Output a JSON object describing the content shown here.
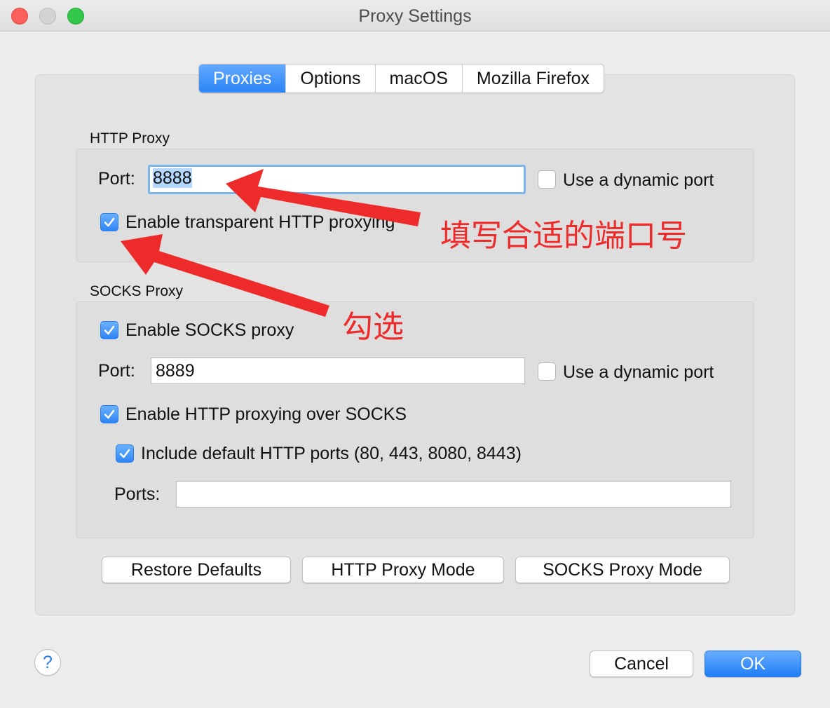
{
  "window": {
    "title": "Proxy Settings"
  },
  "tabs": [
    {
      "label": "Proxies",
      "active": true
    },
    {
      "label": "Options",
      "active": false
    },
    {
      "label": "macOS",
      "active": false
    },
    {
      "label": "Mozilla Firefox",
      "active": false
    }
  ],
  "http_proxy": {
    "section_label": "HTTP Proxy",
    "port_label": "Port:",
    "port_value": "8888",
    "dynamic_port_label": "Use a dynamic port",
    "dynamic_port_checked": false,
    "transparent_label": "Enable transparent HTTP proxying",
    "transparent_checked": true
  },
  "socks_proxy": {
    "section_label": "SOCKS Proxy",
    "enable_label": "Enable SOCKS proxy",
    "enable_checked": true,
    "port_label": "Port:",
    "port_value": "8889",
    "dynamic_port_label": "Use a dynamic port",
    "dynamic_port_checked": false,
    "http_over_socks_label": "Enable HTTP proxying over SOCKS",
    "http_over_socks_checked": true,
    "include_default_label": "Include default HTTP ports (80, 443, 8080, 8443)",
    "include_default_checked": true,
    "ports_label": "Ports:",
    "ports_value": ""
  },
  "buttons": {
    "restore_defaults": "Restore Defaults",
    "http_proxy_mode": "HTTP Proxy Mode",
    "socks_proxy_mode": "SOCKS Proxy Mode",
    "cancel": "Cancel",
    "ok": "OK",
    "help": "?"
  },
  "annotations": {
    "port_note": "填写合适的端口号",
    "check_note": "勾选",
    "color": "#ee2b2b"
  },
  "colors": {
    "accent": "#2f86f6",
    "background": "#ececec"
  }
}
